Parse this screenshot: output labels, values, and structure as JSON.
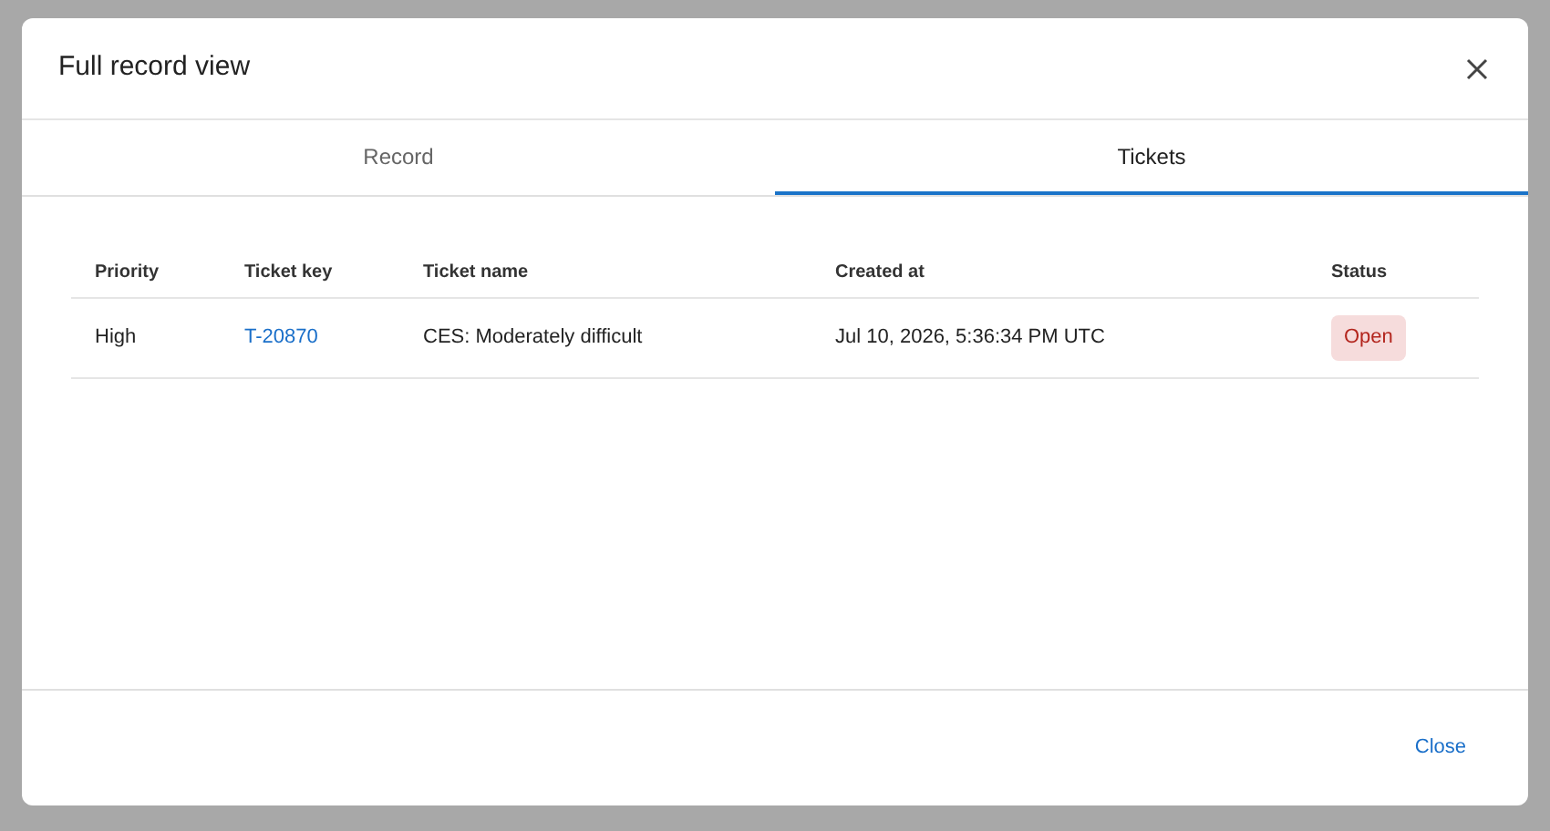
{
  "dialog": {
    "title": "Full record view"
  },
  "tabs": [
    {
      "label": "Record",
      "selected": false
    },
    {
      "label": "Tickets",
      "selected": true
    }
  ],
  "table": {
    "columns": [
      "Priority",
      "Ticket key",
      "Ticket name",
      "Created at",
      "Status"
    ],
    "rows": [
      {
        "priority": "High",
        "ticket_key": "T-20870",
        "ticket_name": "CES: Moderately difficult",
        "created_at": "Jul 10, 2026, 5:36:34 PM UTC",
        "status": {
          "label": "Open",
          "kind": "open"
        }
      }
    ]
  },
  "footer": {
    "button": "Close"
  }
}
